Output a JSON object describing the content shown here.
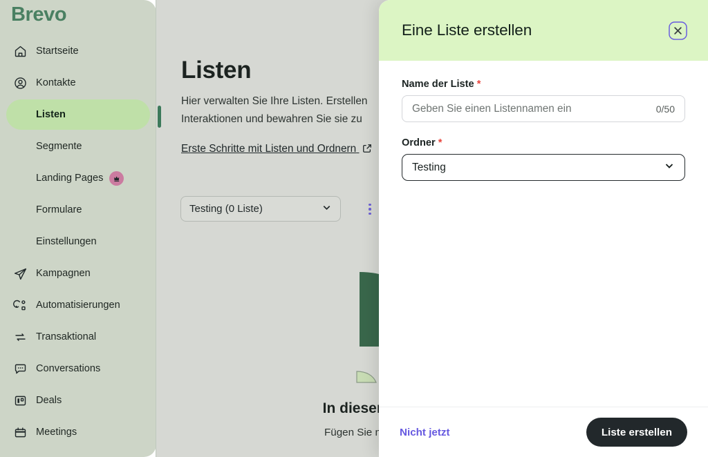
{
  "colors": {
    "brand_green": "#4a8062",
    "sidebar_bg": "#cdd5c7",
    "active_item_bg": "#bfe0a8",
    "active_marker": "#3c7a5b",
    "modal_header_bg": "#dcf5c4",
    "accent_purple": "#6659e0",
    "required_red": "#e8443c",
    "badge_pink": "#cb7ba0",
    "primary_button_bg": "#22282b",
    "page_dim_bg": "#d6d8d3",
    "illustration_dark_green": "#39674b",
    "illustration_light_green": "#c8dcb4"
  },
  "sidebar": {
    "brand": "Brevo",
    "items": [
      {
        "label": "Startseite",
        "icon": "home-icon",
        "level": "top",
        "active": false,
        "badge": null
      },
      {
        "label": "Kontakte",
        "icon": "user-circle-icon",
        "level": "top",
        "active": false,
        "badge": null
      },
      {
        "label": "Listen",
        "icon": null,
        "level": "sub",
        "active": true,
        "badge": null
      },
      {
        "label": "Segmente",
        "icon": null,
        "level": "sub",
        "active": false,
        "badge": null
      },
      {
        "label": "Landing Pages",
        "icon": null,
        "level": "sub",
        "active": false,
        "badge": "crown-icon"
      },
      {
        "label": "Formulare",
        "icon": null,
        "level": "sub",
        "active": false,
        "badge": null
      },
      {
        "label": "Einstellungen",
        "icon": null,
        "level": "sub",
        "active": false,
        "badge": null
      },
      {
        "label": "Kampagnen",
        "icon": "paper-plane-icon",
        "level": "top",
        "active": false,
        "badge": null
      },
      {
        "label": "Automatisierungen",
        "icon": "automation-icon",
        "level": "top",
        "active": false,
        "badge": null
      },
      {
        "label": "Transaktional",
        "icon": "transactional-icon",
        "level": "top",
        "active": false,
        "badge": null
      },
      {
        "label": "Conversations",
        "icon": "chat-bubble-icon",
        "level": "top",
        "active": false,
        "badge": null
      },
      {
        "label": "Deals",
        "icon": "deals-icon",
        "level": "top",
        "active": false,
        "badge": null
      },
      {
        "label": "Meetings",
        "icon": "calendar-icon",
        "level": "top",
        "active": false,
        "badge": null
      }
    ]
  },
  "main": {
    "title": "Listen",
    "description": "Hier verwalten Sie Ihre Listen. Erstellen Interaktionen und bewahren Sie sie zu",
    "help_link": "Erste Schritte mit Listen und Ordnern",
    "help_link_icon": "external-link-icon",
    "folder_dropdown": {
      "value": "Testing (0 Liste)",
      "icon": "chevron-down-icon"
    },
    "more_menu_icon": "kebab-menu-icon",
    "empty_state": {
      "title": "In diesem Ordner",
      "subtitle": "Fügen Sie neue Listen hi"
    }
  },
  "modal": {
    "title": "Eine Liste erstellen",
    "close_icon": "close-icon",
    "fields": [
      {
        "label": "Name der Liste",
        "required_marker": "*",
        "type": "text",
        "value": "",
        "placeholder": "Geben Sie einen Listennamen ein",
        "counter": "0/50"
      },
      {
        "label": "Ordner",
        "required_marker": "*",
        "type": "select",
        "value": "Testing",
        "icon": "chevron-down-icon"
      }
    ],
    "footer": {
      "secondary_label": "Nicht jetzt",
      "primary_label": "Liste erstellen"
    }
  }
}
